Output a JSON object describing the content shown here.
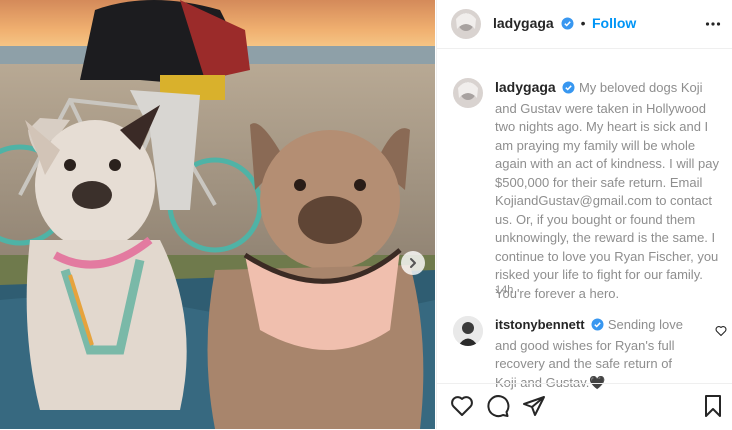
{
  "post": {
    "author": "ladygaga",
    "follow_label": "Follow",
    "caption": "My beloved dogs Koji and Gustav were taken in Hollywood two nights ago. My heart is sick and I am praying my family will be whole again with an act of kindness. I will pay $500,000 for their safe return. Email KojiandGustav@gmail.com to contact us. Or, if you bought or found them unknowingly, the reward is the same. I continue to love you Ryan Fischer, you risked your life to fight for our family. You're forever a hero.",
    "time_ago": "14h"
  },
  "comments": [
    {
      "author": "itstonybennett",
      "text": "Sending love and good wishes for Ryan's full recovery and the safe return of Koji and Gustav.🖤"
    }
  ],
  "icons": {
    "verified": "verified-badge-icon",
    "more": "more-options-icon",
    "like": "heart-icon",
    "comment": "comment-bubble-icon",
    "share": "share-paper-plane-icon",
    "save": "bookmark-icon",
    "next": "chevron-right-icon"
  },
  "colors": {
    "link_blue": "#0095f6",
    "text_dark": "#262626",
    "text_gray": "#8e8e8e",
    "border": "#efefef"
  }
}
